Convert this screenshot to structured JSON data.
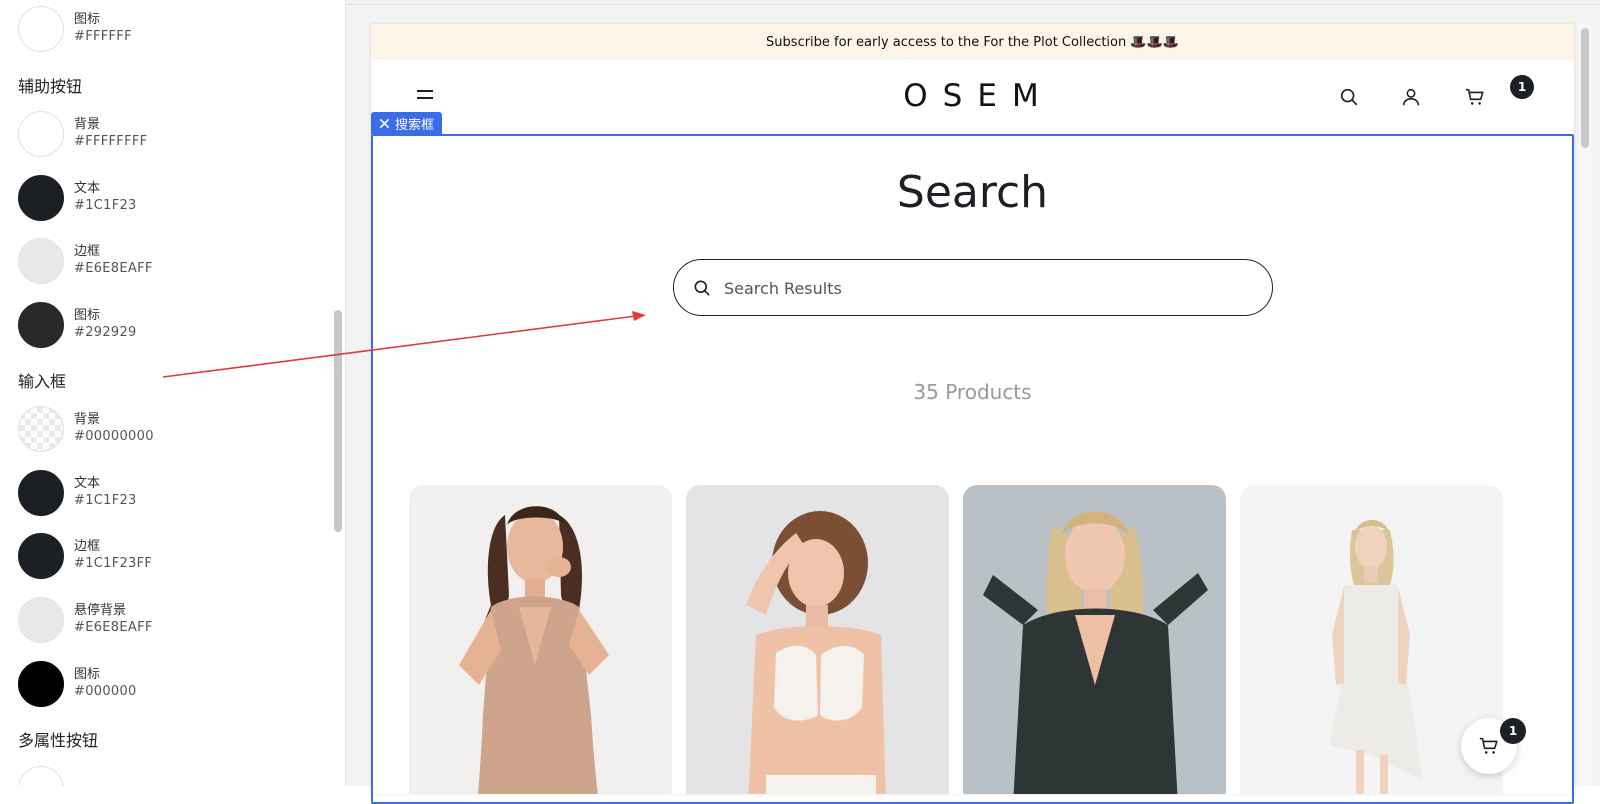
{
  "settings": {
    "partial_top": {
      "name": "图标",
      "hex": "#FFFFFF",
      "color": "#FFFFFF"
    },
    "secondary_button": {
      "title": "辅助按钮",
      "items": [
        {
          "name": "背景",
          "hex": "#FFFFFFFF",
          "color": "#FFFFFF"
        },
        {
          "name": "文本",
          "hex": "#1C1F23",
          "color": "#1C1F23"
        },
        {
          "name": "边框",
          "hex": "#E6E8EAFF",
          "color": "#E6E8EA"
        },
        {
          "name": "图标",
          "hex": "#292929",
          "color": "#292929"
        }
      ]
    },
    "input_box": {
      "title": "输入框",
      "items": [
        {
          "name": "背景",
          "hex": "#00000000",
          "color": "transparent"
        },
        {
          "name": "文本",
          "hex": "#1C1F23",
          "color": "#1C1F23"
        },
        {
          "name": "边框",
          "hex": "#1C1F23FF",
          "color": "#1C1F23"
        },
        {
          "name": "悬停背景",
          "hex": "#E6E8EAFF",
          "color": "#E6E8EA"
        },
        {
          "name": "图标",
          "hex": "#000000",
          "color": "#000000"
        }
      ]
    },
    "multi_attr_button": {
      "title": "多属性按钮"
    }
  },
  "preview": {
    "announcement": "Subscribe for early access to the For the Plot Collection 🎩🎩🎩",
    "logo": "OSEM",
    "cart_count": "1",
    "selection_tag": "搜索框",
    "search": {
      "title": "Search",
      "placeholder": "Search Results"
    },
    "products_count": "35 Products",
    "products": [
      {
        "name": "product-sequin-wrap-dress"
      },
      {
        "name": "product-white-striped-top"
      },
      {
        "name": "product-black-sequin-dress"
      },
      {
        "name": "product-white-halter-dress"
      }
    ],
    "floating_cart_count": "1"
  },
  "colors": {
    "accent_selection": "#3c6ce6",
    "announcement_bg": "#fdf5e7",
    "annotation_arrow": "#e53935"
  }
}
